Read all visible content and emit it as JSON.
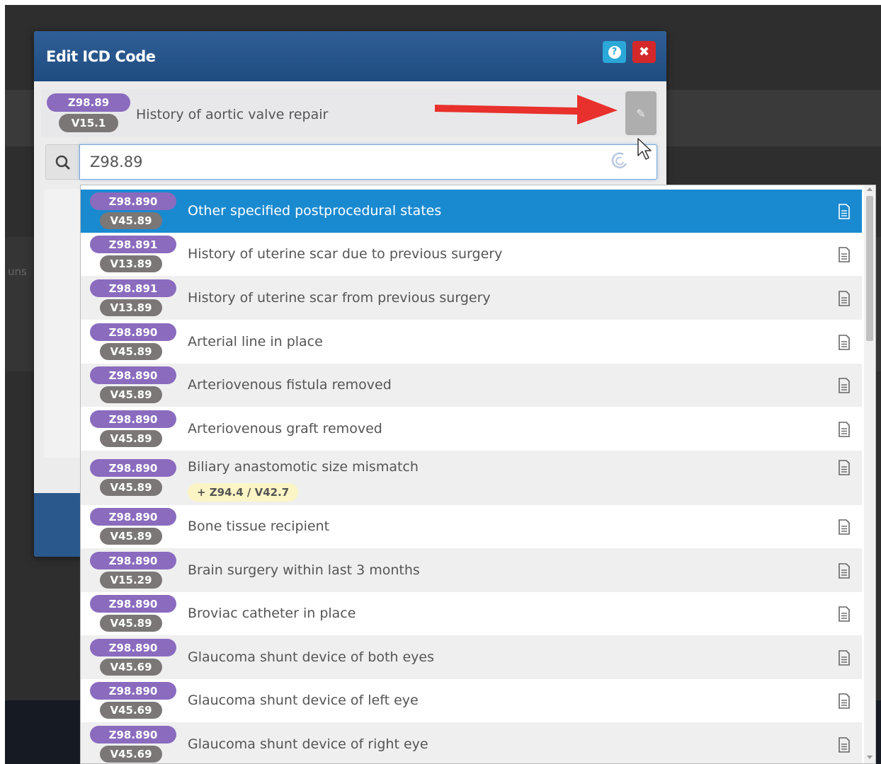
{
  "modal": {
    "title": "Edit ICD Code",
    "help_icon": "question-circle-icon",
    "help_glyph": "?",
    "close_icon": "close-icon",
    "close_glyph": "✖"
  },
  "background": {
    "partial_text": "uns"
  },
  "current_code": {
    "icd10": "Z98.89",
    "icd9": "V15.1",
    "description": "History of aortic valve repair",
    "edit_icon": "edit-icon",
    "edit_glyph": "✎"
  },
  "search": {
    "value": "Z98.89",
    "icon": "search-icon"
  },
  "results": [
    {
      "icd10": "Z98.890",
      "icd9": "V45.89",
      "description": "Other specified postprocedural states",
      "selected": true
    },
    {
      "icd10": "Z98.891",
      "icd9": "V13.89",
      "description": "History of uterine scar due to previous surgery"
    },
    {
      "icd10": "Z98.891",
      "icd9": "V13.89",
      "description": "History of uterine scar from previous surgery"
    },
    {
      "icd10": "Z98.890",
      "icd9": "V45.89",
      "description": "Arterial line in place"
    },
    {
      "icd10": "Z98.890",
      "icd9": "V45.89",
      "description": "Arteriovenous fistula removed"
    },
    {
      "icd10": "Z98.890",
      "icd9": "V45.89",
      "description": "Arteriovenous graft removed"
    },
    {
      "icd10": "Z98.890",
      "icd9": "V45.89",
      "description": "Biliary anastomotic size mismatch",
      "additional": "+ Z94.4 / V42.7"
    },
    {
      "icd10": "Z98.890",
      "icd9": "V45.89",
      "description": "Bone tissue recipient"
    },
    {
      "icd10": "Z98.890",
      "icd9": "V15.29",
      "description": "Brain surgery within last 3 months"
    },
    {
      "icd10": "Z98.890",
      "icd9": "V45.89",
      "description": "Broviac catheter in place"
    },
    {
      "icd10": "Z98.890",
      "icd9": "V45.69",
      "description": "Glaucoma shunt device of both eyes"
    },
    {
      "icd10": "Z98.890",
      "icd9": "V45.69",
      "description": "Glaucoma shunt device of left eye"
    },
    {
      "icd10": "Z98.890",
      "icd9": "V45.69",
      "description": "Glaucoma shunt device of right eye"
    }
  ],
  "colors": {
    "header_blue": "#2a588c",
    "selected_blue": "#1a8ad0",
    "icd10_pill": "#8a6bbe",
    "icd9_pill": "#7b7777",
    "help_button": "#2aa8d8",
    "close_button": "#d4282a",
    "annotation_arrow": "#e8302c"
  }
}
